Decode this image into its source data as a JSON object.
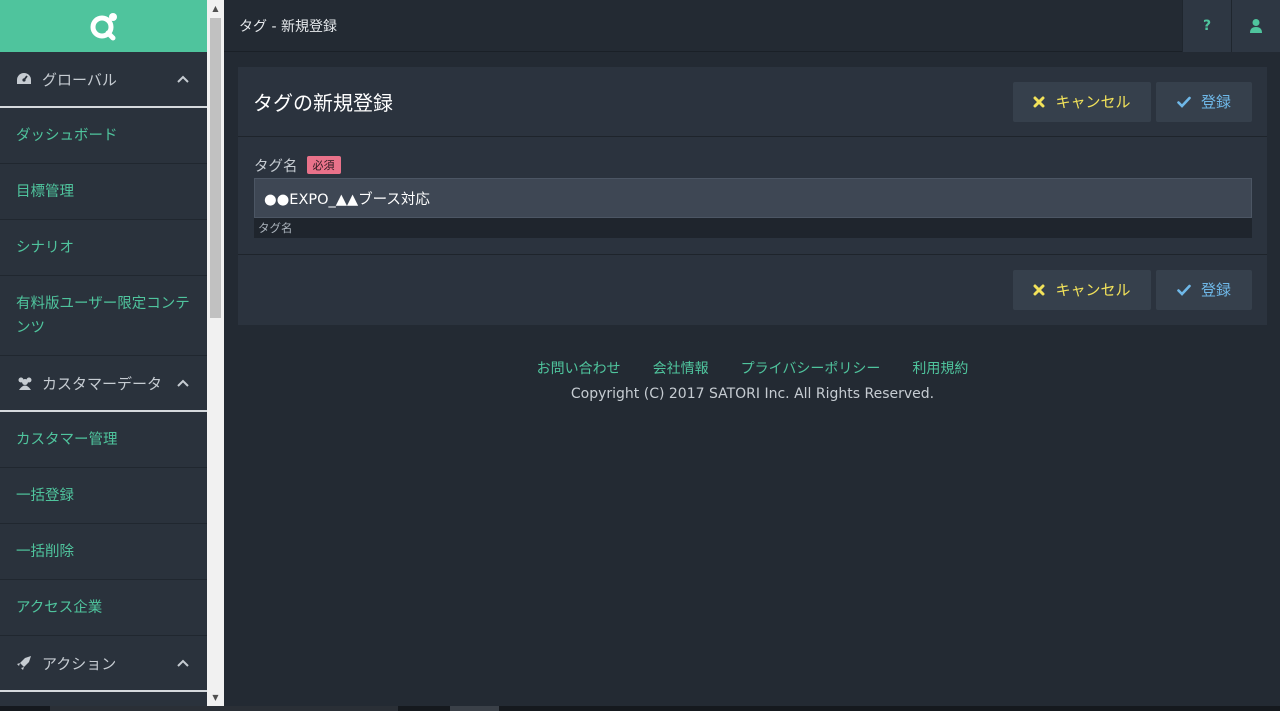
{
  "sidebar": {
    "logo_icon": "satori-logo",
    "sections": [
      {
        "label": "グローバル",
        "icon": "dashboard-icon",
        "items": [
          "ダッシュボード",
          "目標管理",
          "シナリオ",
          "有料版ユーザー限定コンテンツ"
        ]
      },
      {
        "label": "カスタマーデータ",
        "icon": "users-icon",
        "items": [
          "カスタマー管理",
          "一括登録",
          "一括削除",
          "アクセス企業"
        ]
      },
      {
        "label": "アクション",
        "icon": "rocket-icon",
        "items": []
      }
    ]
  },
  "header": {
    "title": "タグ - 新規登録",
    "help_label": "?",
    "user_icon": "user-icon"
  },
  "panel": {
    "title": "タグの新規登録",
    "cancel_label": "キャンセル",
    "save_label": "登録",
    "field": {
      "label": "タグ名",
      "required": "必須",
      "value": "●●EXPO_▲▲ブース対応",
      "hint": "タグ名"
    }
  },
  "footer": {
    "links": [
      "お問い合わせ",
      "会社情報",
      "プライバシーポリシー",
      "利用規約"
    ],
    "copyright": "Copyright (C) 2017 SATORI Inc. All Rights Reserved."
  },
  "colors": {
    "accent": "#4fc49d",
    "background": "#232a33",
    "panel": "#2b333e",
    "cancel": "#f2e25a",
    "save": "#6fb8e8",
    "required": "#e9728a"
  }
}
